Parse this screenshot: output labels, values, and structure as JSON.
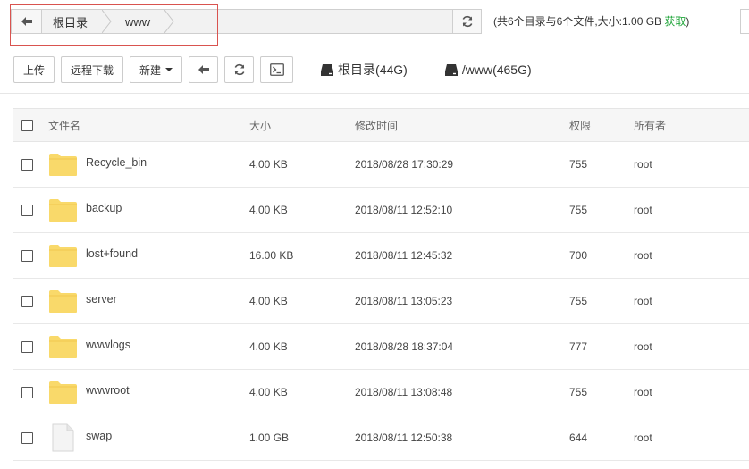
{
  "address_bar": {
    "crumbs": [
      "根目录",
      "www"
    ]
  },
  "dir_summary": {
    "text": "(共6个目录与6个文件,大小:1.00 GB",
    "get_link": "获取",
    "close": ")"
  },
  "toolbar": {
    "upload_label": "上传",
    "remote_download_label": "远程下载",
    "new_label": "新建",
    "disks": [
      {
        "label": "根目录(44G)"
      },
      {
        "label": "/www(465G)"
      }
    ]
  },
  "table": {
    "headers": {
      "name": "文件名",
      "size": "大小",
      "modified": "修改时间",
      "permission": "权限",
      "owner": "所有者"
    },
    "rows": [
      {
        "type": "folder",
        "name": "Recycle_bin",
        "size": "4.00 KB",
        "modified": "2018/08/28 17:30:29",
        "permission": "755",
        "owner": "root"
      },
      {
        "type": "folder",
        "name": "backup",
        "size": "4.00 KB",
        "modified": "2018/08/11 12:52:10",
        "permission": "755",
        "owner": "root"
      },
      {
        "type": "folder",
        "name": "lost+found",
        "size": "16.00 KB",
        "modified": "2018/08/11 12:45:32",
        "permission": "700",
        "owner": "root"
      },
      {
        "type": "folder",
        "name": "server",
        "size": "4.00 KB",
        "modified": "2018/08/11 13:05:23",
        "permission": "755",
        "owner": "root"
      },
      {
        "type": "folder",
        "name": "wwwlogs",
        "size": "4.00 KB",
        "modified": "2018/08/28 18:37:04",
        "permission": "777",
        "owner": "root"
      },
      {
        "type": "folder",
        "name": "wwwroot",
        "size": "4.00 KB",
        "modified": "2018/08/11 13:08:48",
        "permission": "755",
        "owner": "root"
      },
      {
        "type": "file",
        "name": "swap",
        "size": "1.00 GB",
        "modified": "2018/08/11 12:50:38",
        "permission": "644",
        "owner": "root"
      }
    ]
  },
  "colors": {
    "folder": "#f9d96a",
    "accent_green": "#20a53a",
    "highlight_border": "#d9534f"
  },
  "icons": {
    "back": "arrow-left-icon",
    "refresh": "refresh-icon",
    "terminal": "terminal-icon",
    "disk": "hard-disk-icon",
    "folder": "folder-icon",
    "file": "file-icon"
  }
}
